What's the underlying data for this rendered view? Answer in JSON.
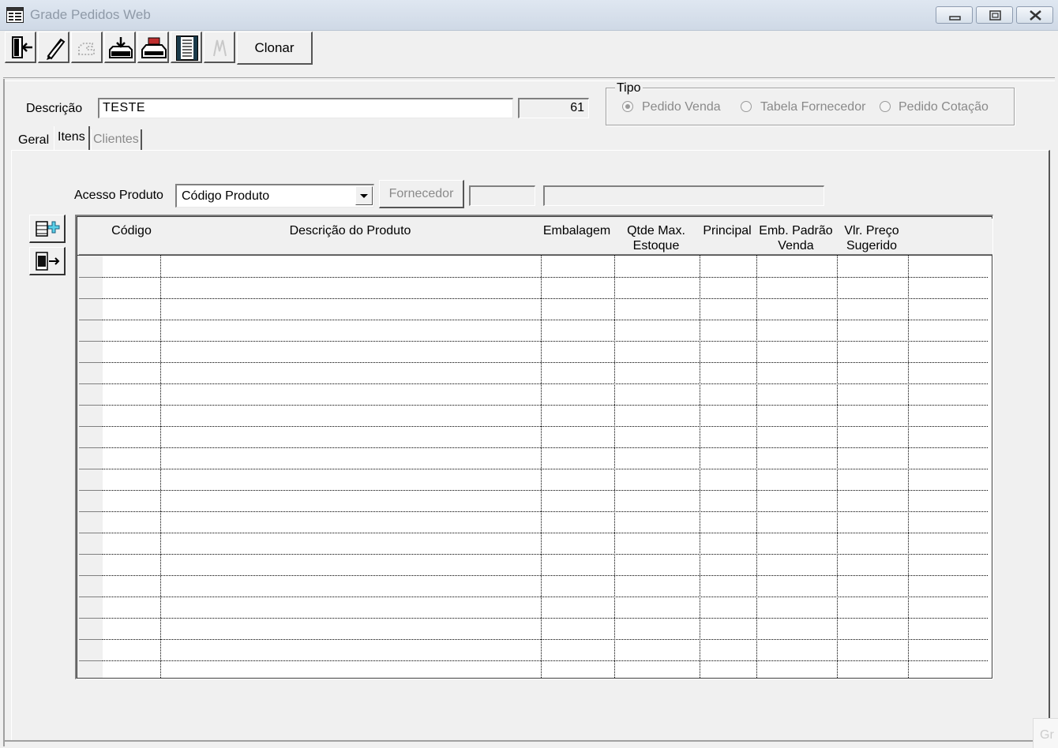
{
  "window": {
    "title": "Grade Pedidos Web",
    "icon": "form-grid-icon",
    "controls": [
      "minimize-icon",
      "restore-icon",
      "close-icon"
    ]
  },
  "toolbar": {
    "buttons": [
      {
        "icon": "exit-door-icon",
        "enabled": true
      },
      {
        "icon": "edit-pencil-icon",
        "enabled": true
      },
      {
        "icon": "undo-hand-icon",
        "enabled": false
      },
      {
        "icon": "save-tray-icon",
        "enabled": true
      },
      {
        "icon": "print-icon",
        "enabled": true
      },
      {
        "icon": "list-view-icon",
        "enabled": true
      },
      {
        "icon": "sign-icon",
        "enabled": false
      }
    ],
    "clone_label": "Clonar"
  },
  "form": {
    "descricao_label": "Descrição",
    "descricao_value": "TESTE",
    "code_value": "61"
  },
  "tipo": {
    "title": "Tipo",
    "options": [
      {
        "label": "Pedido Venda",
        "selected": true
      },
      {
        "label": "Tabela Fornecedor",
        "selected": false
      },
      {
        "label": "Pedido Cotação",
        "selected": false
      }
    ]
  },
  "tabs": [
    {
      "label": "Geral",
      "active": false
    },
    {
      "label": "Itens",
      "active": true
    },
    {
      "label": "Clientes",
      "active": false
    }
  ],
  "itens": {
    "acesso_label": "Acesso Produto",
    "acesso_value": "Código Produto",
    "fornecedor_label": "Fornecedor",
    "side_buttons": [
      "add-row-icon",
      "remove-row-icon"
    ]
  },
  "grid": {
    "columns": [
      "Código",
      "Descrição do Produto",
      "Embalagem",
      "Qtde Max.\nEstoque",
      "Principal",
      "Emb. Padrão\nVenda",
      "Vlr. Preço\nSugerido",
      ""
    ],
    "rows": []
  },
  "overflow_text": "Gr"
}
